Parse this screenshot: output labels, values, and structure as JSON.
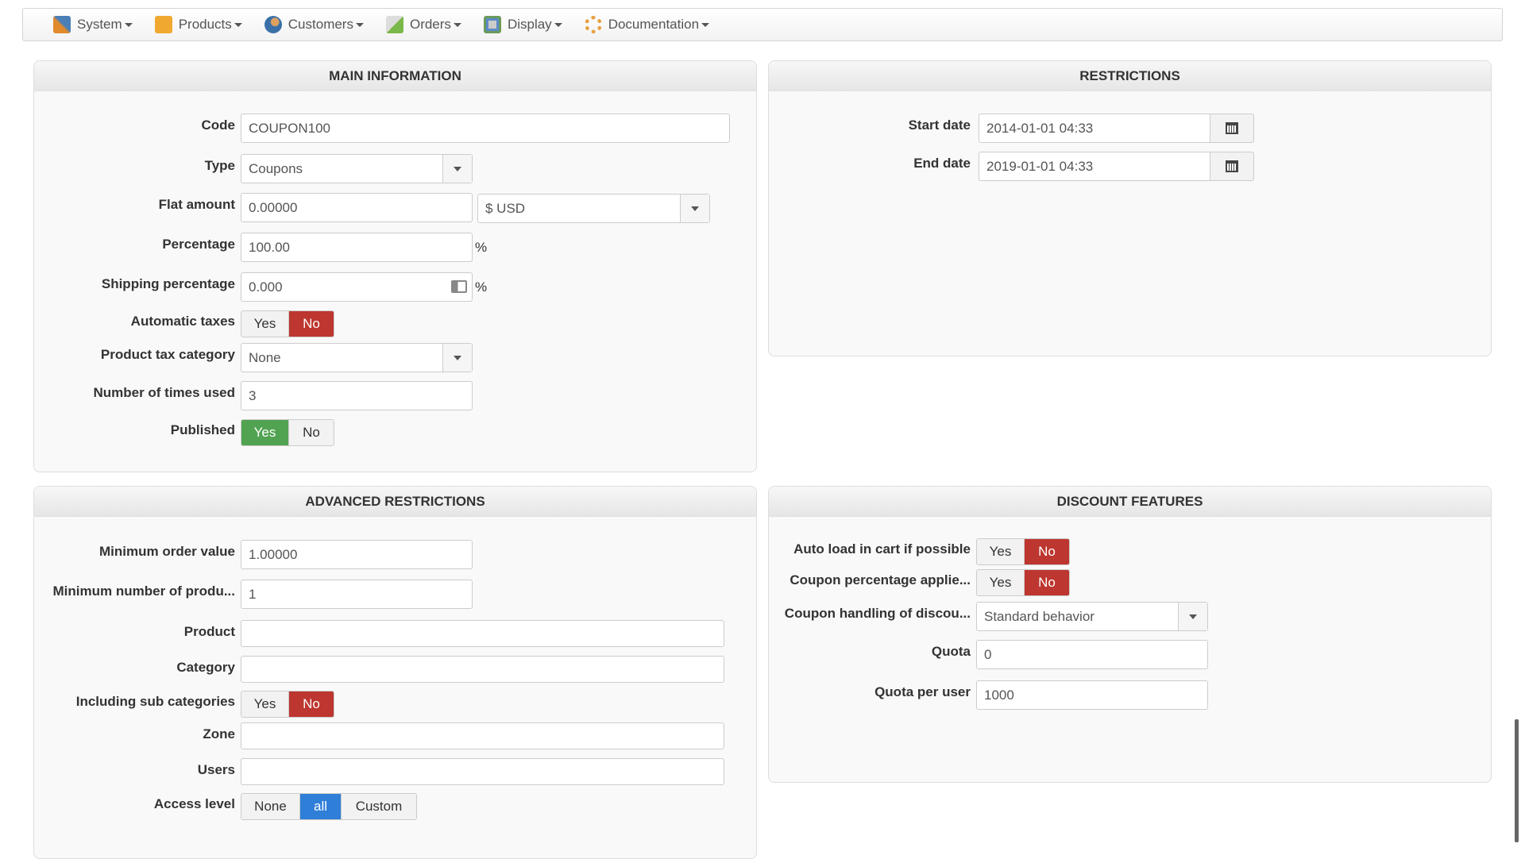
{
  "nav": [
    {
      "label": "System",
      "icon": "tools-icon"
    },
    {
      "label": "Products",
      "icon": "box-icon"
    },
    {
      "label": "Customers",
      "icon": "users-icon"
    },
    {
      "label": "Orders",
      "icon": "orders-icon"
    },
    {
      "label": "Display",
      "icon": "display-icon"
    },
    {
      "label": "Documentation",
      "icon": "lifebuoy-icon"
    }
  ],
  "main": {
    "title": "MAIN INFORMATION",
    "code_label": "Code",
    "code": "COUPON100",
    "type_label": "Type",
    "type": "Coupons",
    "flat_label": "Flat amount",
    "flat": "0.00000",
    "currency": "$ USD",
    "pct_label": "Percentage",
    "pct": "100.00",
    "pct_sign": "%",
    "ship_label": "Shipping percentage",
    "ship": "0.000",
    "autotax_label": "Automatic taxes",
    "yes": "Yes",
    "no": "No",
    "taxcat_label": "Product tax category",
    "taxcat": "None",
    "used_label": "Number of times used",
    "used": "3",
    "pub_label": "Published"
  },
  "restrictions": {
    "title": "RESTRICTIONS",
    "start_label": "Start date",
    "start": "2014-01-01 04:33",
    "end_label": "End date",
    "end": "2019-01-01 04:33"
  },
  "advanced": {
    "title": "ADVANCED RESTRICTIONS",
    "minorder_label": "Minimum order value",
    "minorder": "1.00000",
    "minprod_label": "Minimum number of produ...",
    "minprod": "1",
    "product_label": "Product",
    "product": "",
    "category_label": "Category",
    "category": "",
    "subcat_label": "Including sub categories",
    "zone_label": "Zone",
    "zone": "",
    "users_label": "Users",
    "users": "",
    "access_label": "Access level",
    "access_options": [
      "None",
      "all",
      "Custom"
    ]
  },
  "discount": {
    "title": "DISCOUNT FEATURES",
    "autoload_label": "Auto load in cart if possible",
    "couponpct_label": "Coupon percentage applie...",
    "handling_label": "Coupon handling of discou...",
    "handling": "Standard behavior",
    "quota_label": "Quota",
    "quota": "0",
    "quotauser_label": "Quota per user",
    "quotauser": "1000"
  },
  "colors": {
    "no_active": "#bd362f",
    "yes_active": "#51a351",
    "all_active": "#2f7ed8"
  }
}
